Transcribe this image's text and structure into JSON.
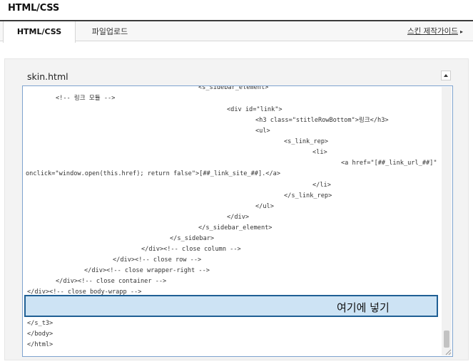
{
  "page": {
    "title": "HTML/CSS"
  },
  "tabs": [
    {
      "label": "HTML/CSS",
      "active": true
    },
    {
      "label": "파일업로드",
      "active": false
    }
  ],
  "guide_link": {
    "label": "스킨 제작가이드",
    "arrow": "▸"
  },
  "editor": {
    "file_name": "skin.html",
    "lines": [
      "<s_sidebar_element>",
      "<!-- 링크 모듈 -->",
      "<div id=\"link\">",
      "<h3 class=\"stitleRowBottom\">링크</h3>",
      "<ul>",
      "<s_link_rep>",
      "<li>",
      "<a href=\"[##_link_url_##]\"",
      "onclick=\"window.open(this.href); return false\">[##_link_site_##].</a>",
      "</li>",
      "</s_link_rep>",
      "</ul>",
      "</div>",
      "</s_sidebar_element>",
      "</s_sidebar>",
      "</div><!-- close column -->",
      "</div><!-- close row -->",
      "</div><!-- close wrapper-right -->",
      "</div><!-- close container -->",
      "</div><!-- close body-wrapp -->",
      "</s_t3>",
      "</body>",
      "</html>"
    ]
  },
  "annotation": {
    "text": "여기에 넣기"
  },
  "colors": {
    "highlight_fill": "#cde3f4",
    "highlight_border": "#1f5f94",
    "editor_border": "#7ea3cf"
  }
}
